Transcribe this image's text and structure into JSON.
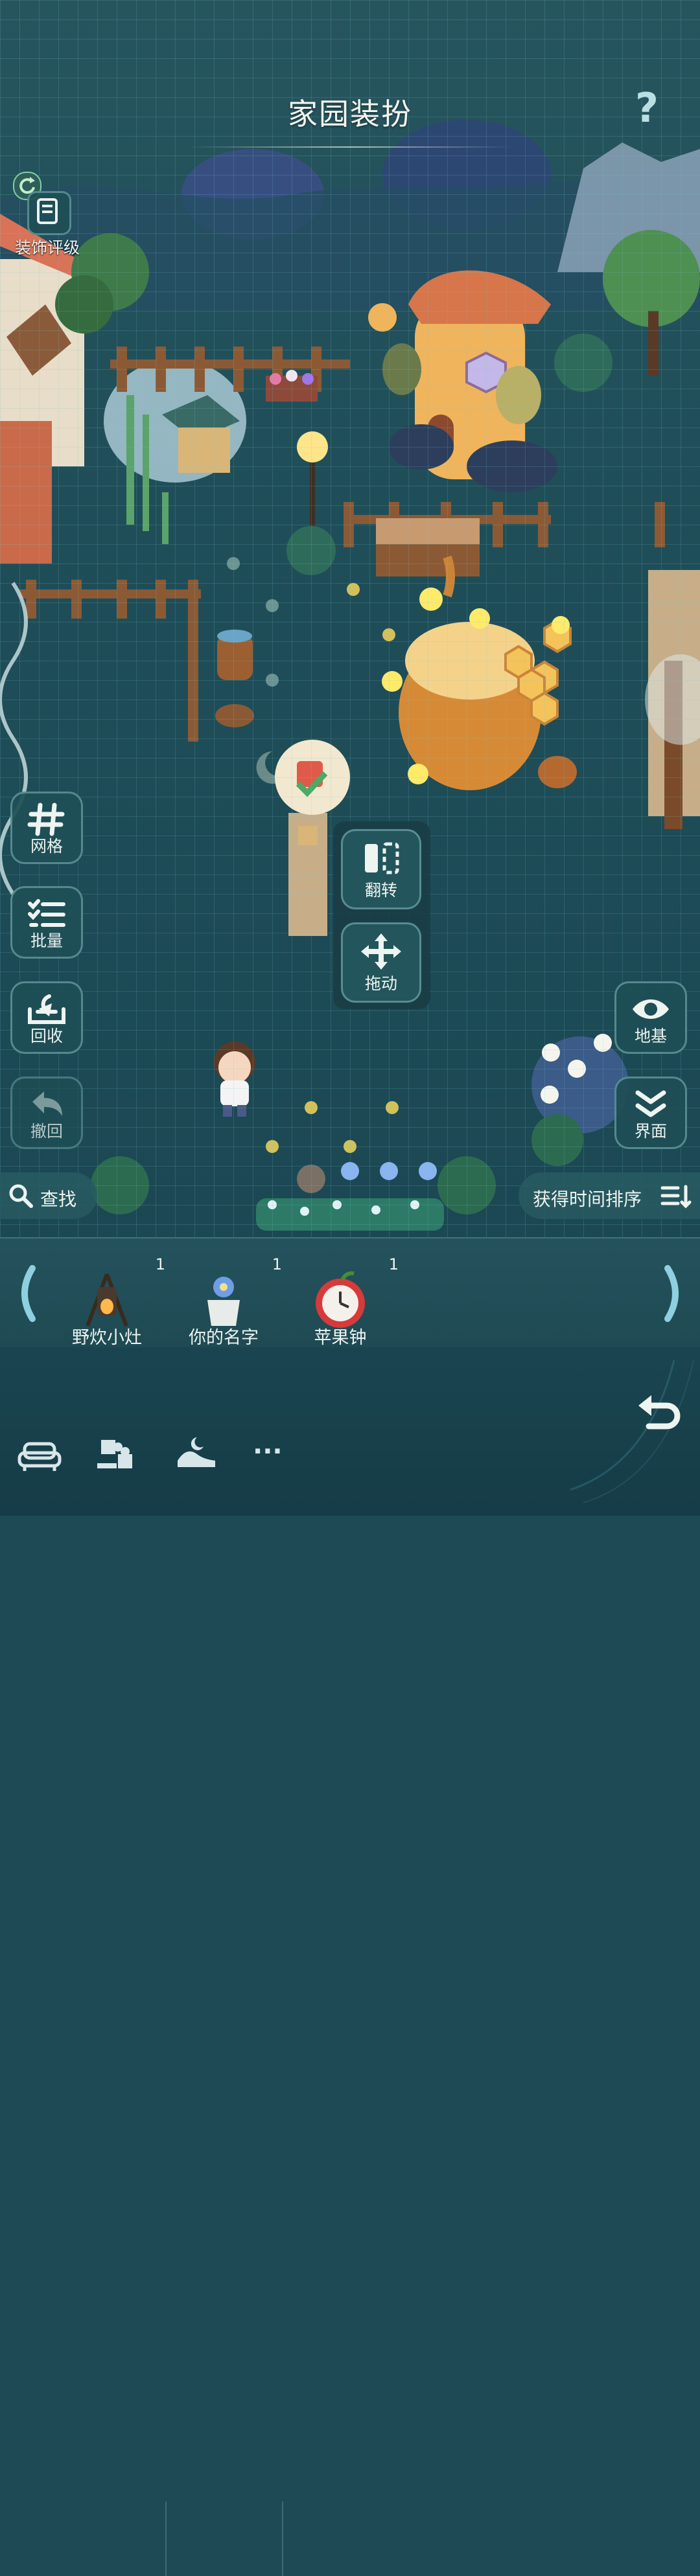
{
  "header": {
    "title": "家园装扮",
    "help_icon": "?"
  },
  "left_panel": {
    "rating_label": "装饰评级",
    "grid_label": "网格",
    "batch_label": "批量",
    "recycle_label": "回收",
    "undo_label": "撤回"
  },
  "action_menu": {
    "flip_label": "翻转",
    "drag_label": "拖动"
  },
  "right_panel": {
    "foundation_label": "地基",
    "interface_label": "界面"
  },
  "search": {
    "label": "查找"
  },
  "sort": {
    "label": "获得时间排序"
  },
  "inventory": {
    "items": [
      {
        "name": "野炊小灶",
        "count": "1"
      },
      {
        "name": "你的名字",
        "count": "1"
      },
      {
        "name": "苹果钟",
        "count": "1"
      }
    ]
  },
  "bottom_bar": {
    "icons": [
      "sofa-icon",
      "puzzle-icon",
      "landscape-icon",
      "more-icon"
    ],
    "more_label": "···"
  },
  "colors": {
    "background": "#1f4e59",
    "panel": "#1e4e56",
    "text": "#eef4f0",
    "accent": "#b8e0e4"
  }
}
